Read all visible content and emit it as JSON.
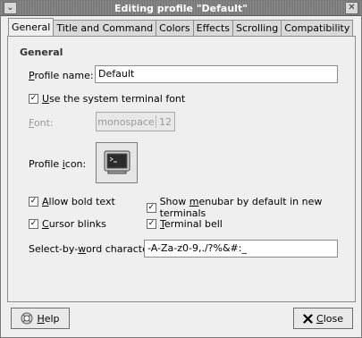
{
  "window": {
    "title": "Editing profile \"Default\"",
    "menu_glyph": "⌄",
    "close_glyph": "✕"
  },
  "tabs": [
    {
      "label": "General",
      "active": true
    },
    {
      "label": "Title and Command"
    },
    {
      "label": "Colors"
    },
    {
      "label": "Effects"
    },
    {
      "label": "Scrolling"
    },
    {
      "label": "Compatibility"
    }
  ],
  "general": {
    "section_title": "General",
    "profile_name": {
      "prefix": "",
      "mnemonic": "P",
      "rest": "rofile name:",
      "value": "Default"
    },
    "use_system_font": {
      "mnemonic": "U",
      "rest": "se the system terminal font",
      "checked": true
    },
    "font": {
      "mnemonic": "F",
      "rest": "ont:",
      "name": "monospace",
      "size": "12"
    },
    "profile_icon": {
      "prefix": "Profile ",
      "mnemonic": "i",
      "rest": "con:",
      "icon": "terminal-icon"
    },
    "allow_bold": {
      "mnemonic": "A",
      "rest": "llow bold text",
      "checked": true
    },
    "show_menubar": {
      "prefix": "Show ",
      "mnemonic": "m",
      "rest": "enubar by default in new terminals",
      "checked": true
    },
    "cursor_blinks": {
      "mnemonic": "C",
      "rest": "ursor blinks",
      "checked": true
    },
    "terminal_bell": {
      "prefix": "",
      "mnemonic": "T",
      "rest": "erminal bell",
      "checked": true
    },
    "word_chars": {
      "prefix": "Select-by-",
      "mnemonic": "w",
      "rest": "ord characters:",
      "value": "-A-Za-z0-9,./?%&#:_"
    }
  },
  "buttons": {
    "help": {
      "mnemonic": "H",
      "rest": "elp",
      "icon": "help-icon"
    },
    "close": {
      "mnemonic": "C",
      "rest": "lose",
      "icon": "close-x-icon"
    }
  },
  "colors": {
    "check_mark": "✓"
  }
}
